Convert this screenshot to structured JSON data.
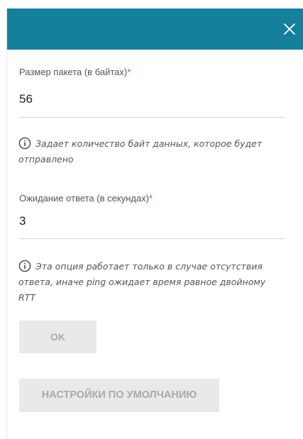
{
  "dialog": {
    "close_icon": "close-icon",
    "header_color": "#14809b"
  },
  "packet_size": {
    "label": "Размер пакета (в байтах)",
    "required_mark": "*",
    "value": "56",
    "hint": "Задает количество байт данных, которое будет отправлено"
  },
  "timeout": {
    "label": "Ожидание ответа (в секундах)",
    "required_mark": "*",
    "value": "3",
    "hint": "Эта опция работает только в случае отсутствия ответа, иначе ping ожидает время равное двойному RTT"
  },
  "buttons": {
    "ok_label": "OK",
    "default_label": "НАСТРОЙКИ ПО УМОЛЧАНИЮ"
  }
}
